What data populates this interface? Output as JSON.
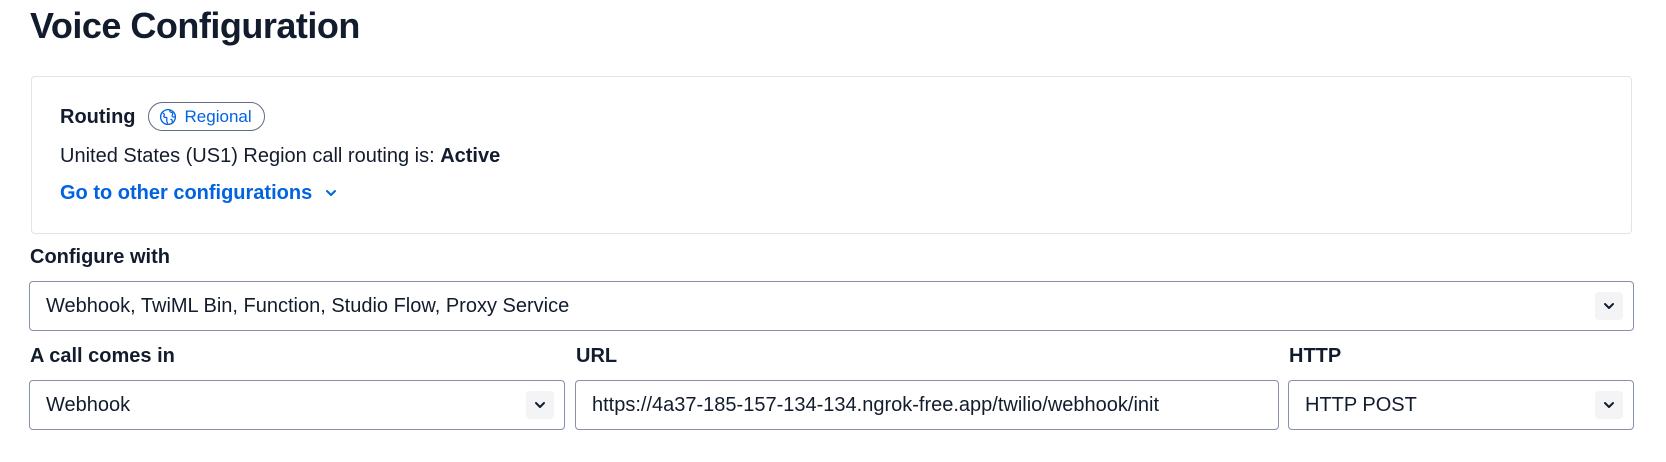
{
  "page_title": "Voice Configuration",
  "routing": {
    "label": "Routing",
    "badge_label": "Regional",
    "badge_icon": "globe-icon",
    "status_prefix": "United States (US1) Region call routing is: ",
    "status_value": "Active",
    "other_config_link": "Go to other configurations"
  },
  "configure_with": {
    "label": "Configure with",
    "value": "Webhook, TwiML Bin, Function, Studio Flow, Proxy Service"
  },
  "call_comes_in": {
    "label": "A call comes in",
    "value": "Webhook"
  },
  "url": {
    "label": "URL",
    "value": "https://4a37-185-157-134-134.ngrok-free.app/twilio/webhook/init"
  },
  "http": {
    "label": "HTTP",
    "value": "HTTP POST"
  },
  "colors": {
    "link_blue": "#0263e0",
    "text_dark": "#121c2d",
    "border": "#8891aa"
  }
}
